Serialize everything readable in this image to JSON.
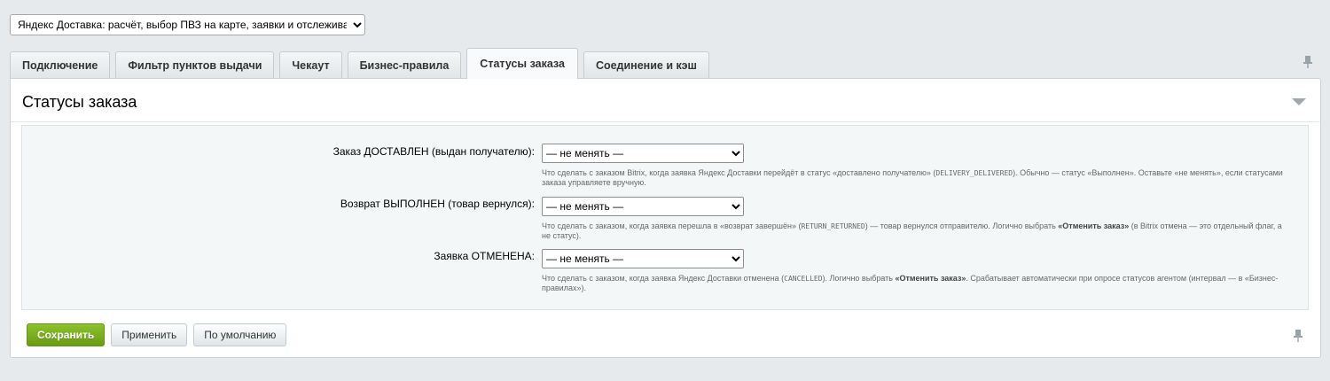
{
  "module_select": {
    "value": "Яндекс Доставка: расчёт, выбор ПВЗ на карте, заявки и отслеживание"
  },
  "tabs": [
    {
      "label": "Подключение",
      "active": false
    },
    {
      "label": "Фильтр пунктов выдачи",
      "active": false
    },
    {
      "label": "Чекаут",
      "active": false
    },
    {
      "label": "Бизнес-правила",
      "active": false
    },
    {
      "label": "Статусы заказа",
      "active": true
    },
    {
      "label": "Соединение и кэш",
      "active": false
    }
  ],
  "panel": {
    "title": "Статусы заказа"
  },
  "rows": [
    {
      "label": "Заказ ДОСТАВЛЕН (выдан получателю):",
      "select_value": "— не менять —",
      "hint_pre": "Что сделать с заказом Bitrix, когда заявка Яндекс Доставки перейдёт в статус «доставлено получателю» (",
      "hint_code": "DELIVERY_DELIVERED",
      "hint_mid": "). Обычно — статус «Выполнен». Оставьте «не менять», если статусами заказа управляете вручную.",
      "hint_bold": "",
      "hint_post": ""
    },
    {
      "label": "Возврат ВЫПОЛНЕН (товар вернулся):",
      "select_value": "— не менять —",
      "hint_pre": "Что сделать с заказом, когда заявка перешла в «возврат завершён» (",
      "hint_code": "RETURN_RETURNED",
      "hint_mid": ") — товар вернулся отправителю. Логично выбрать ",
      "hint_bold": "«Отменить заказ»",
      "hint_post": " (в Bitrix отмена — это отдельный флаг, а не статус)."
    },
    {
      "label": "Заявка ОТМЕНЕНА:",
      "select_value": "— не менять —",
      "hint_pre": "Что сделать с заказом, когда заявка Яндекс Доставки отменена (",
      "hint_code": "CANCELLED",
      "hint_mid": "). Логично выбрать ",
      "hint_bold": "«Отменить заказ»",
      "hint_post": ". Срабатывает автоматически при опросе статусов агентом (интервал — в «Бизнес-правилах»)."
    }
  ],
  "buttons": {
    "save": "Сохранить",
    "apply": "Применить",
    "default": "По умолчанию"
  },
  "colors": {
    "page_bg": "#e6eaec",
    "primary_button": "#7bb01e",
    "form_bg": "#f4f7f8"
  }
}
